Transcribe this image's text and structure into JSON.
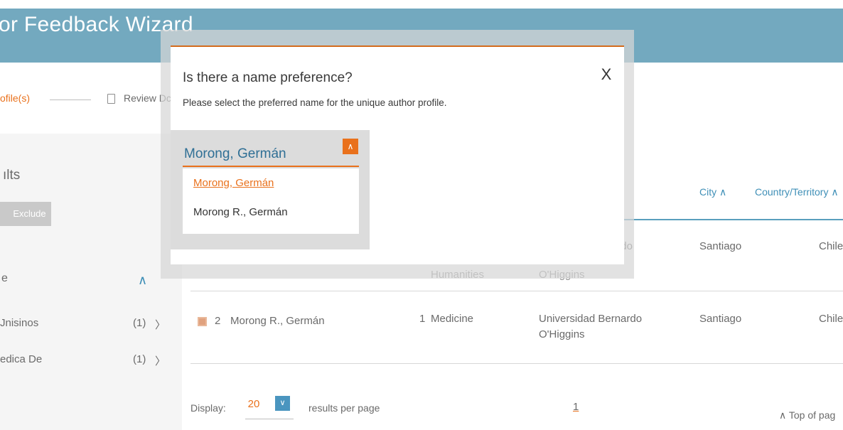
{
  "app": {
    "title": "or Feedback Wizard"
  },
  "steps": {
    "step1_label": "ofile(s)",
    "step2_label": "Review Dc"
  },
  "sidebar": {
    "results_title": "ılts",
    "exclude_label": "Exclude",
    "facet_title": "e",
    "facet_items": [
      {
        "label": "Jnisinos",
        "count": "(1)"
      },
      {
        "label": "edica De",
        "count": "(1)"
      }
    ]
  },
  "table": {
    "headers": {
      "city": "City ∧",
      "country": "Country/Territory ∧"
    },
    "rows": [
      {
        "index": "",
        "name": "",
        "docs": "",
        "subject": "Humanities",
        "affiliation_line1": "ardo",
        "affiliation_line2": "O'Higgins",
        "city": "Santiago",
        "country": "Chile"
      },
      {
        "index": "2",
        "name": "Morong R., Germán",
        "docs": "1",
        "subject": "Medicine",
        "affiliation_line1": "Universidad Bernardo",
        "affiliation_line2": "O'Higgins",
        "city": "Santiago",
        "country": "Chile"
      }
    ]
  },
  "footer": {
    "display_label": "Display:",
    "display_value": "20",
    "display_suffix": "results per page",
    "page": "1",
    "top_link": "∧ Top of pag"
  },
  "modal": {
    "title": "Is there a name preference?",
    "subtitle": "Please select the preferred name for the unique author profile.",
    "close_label": "X",
    "selected_value": "Morong, Germán",
    "options": [
      "Morong, Germán",
      "Morong R., Germán"
    ]
  },
  "colors": {
    "accent": "#e9711c",
    "brand": "#73a9bf",
    "link": "#3f8fb7"
  }
}
